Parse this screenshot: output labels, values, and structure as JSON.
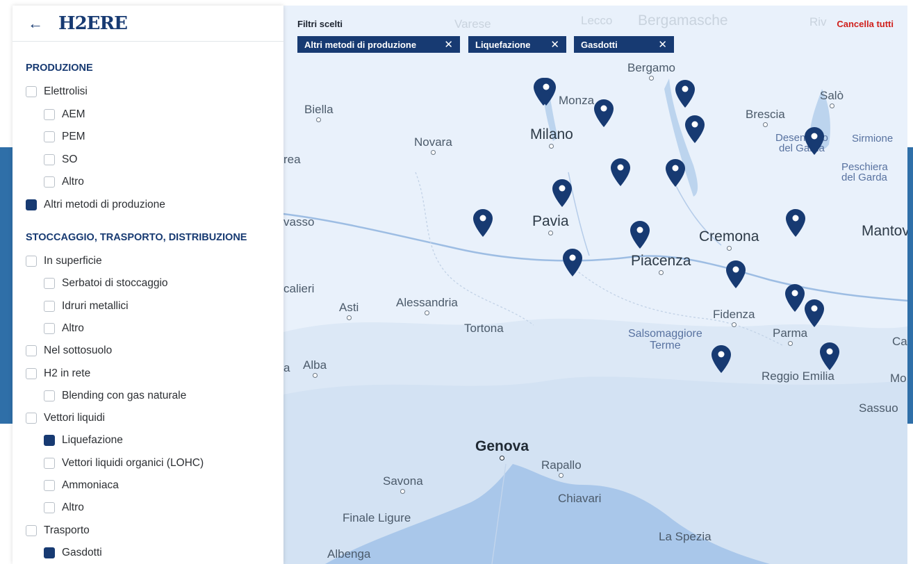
{
  "header": {
    "back_icon": "arrow-left-icon",
    "logo": "H2ERE"
  },
  "filters": {
    "title": "Filtri scelti",
    "clear_all": "Cancella tutti",
    "chips": [
      {
        "label": "Altri metodi di produzione",
        "close": "✕"
      },
      {
        "label": "Liquefazione",
        "close": "✕"
      },
      {
        "label": "Gasdotti",
        "close": "✕"
      }
    ]
  },
  "sidebar": {
    "sections": [
      {
        "title": "PRODUZIONE",
        "items": [
          {
            "label": "Elettrolisi",
            "checked": false,
            "level": 0
          },
          {
            "label": "AEM",
            "checked": false,
            "level": 1
          },
          {
            "label": "PEM",
            "checked": false,
            "level": 1
          },
          {
            "label": "SO",
            "checked": false,
            "level": 1
          },
          {
            "label": "Altro",
            "checked": false,
            "level": 1
          },
          {
            "label": "Altri metodi di produzione",
            "checked": true,
            "level": 0
          }
        ]
      },
      {
        "title": "STOCCAGGIO, TRASPORTO, DISTRIBUZIONE",
        "items": [
          {
            "label": "In superficie",
            "checked": false,
            "level": 0
          },
          {
            "label": "Serbatoi di stoccaggio",
            "checked": false,
            "level": 1
          },
          {
            "label": "Idruri metallici",
            "checked": false,
            "level": 1
          },
          {
            "label": "Altro",
            "checked": false,
            "level": 1
          },
          {
            "label": "Nel sottosuolo",
            "checked": false,
            "level": 0
          },
          {
            "label": "H2 in rete",
            "checked": false,
            "level": 0
          },
          {
            "label": "Blending con gas naturale",
            "checked": false,
            "level": 1
          },
          {
            "label": "Vettori liquidi",
            "checked": false,
            "level": 0
          },
          {
            "label": "Liquefazione",
            "checked": true,
            "level": 1
          },
          {
            "label": "Vettori liquidi organici (LOHC)",
            "checked": false,
            "level": 1
          },
          {
            "label": "Ammoniaca",
            "checked": false,
            "level": 1
          },
          {
            "label": "Altro",
            "checked": false,
            "level": 1
          },
          {
            "label": "Trasporto",
            "checked": false,
            "level": 0
          },
          {
            "label": "Gasdotti",
            "checked": true,
            "level": 1
          }
        ]
      }
    ]
  },
  "map": {
    "cities": {
      "varese": "Varese",
      "lecco": "Lecco",
      "bergamasche": "Bergamasche",
      "riv": "Riv",
      "bergamo": "Bergamo",
      "monza": "Monza",
      "biella": "Biella",
      "salo": "Salò",
      "brescia": "Brescia",
      "milano": "Milano",
      "novara": "Novara",
      "desenzano": "Desenzano\ndel Garda",
      "sirmione": "Sirmione",
      "peschiera": "Peschiera\ndel Garda",
      "rea": "rea",
      "vasso": "vasso",
      "pavia": "Pavia",
      "cremona": "Cremona",
      "mantova": "Mantov",
      "piacenza": "Piacenza",
      "calieri": "calieri",
      "asti": "Asti",
      "alessandria": "Alessandria",
      "tortona": "Tortona",
      "fidenza": "Fidenza",
      "salsomaggiore": "Salsomaggiore\nTerme",
      "parma": "Parma",
      "ca": "Ca",
      "a": "a",
      "alba": "Alba",
      "reggio": "Reggio Emilia",
      "mo": "Mo",
      "sassuolo": "Sassuo",
      "genova": "Genova",
      "rapallo": "Rapallo",
      "savona": "Savona",
      "chiavari": "Chiavari",
      "finale": "Finale Ligure",
      "laspezia": "La Spezia",
      "albenga": "Albenga"
    },
    "pin_count": 18,
    "pin_color": "#173a72",
    "pin_icon": "map-marker-icon"
  },
  "colors": {
    "brand": "#173a72",
    "accent_red": "#d0201c",
    "band": "#2f6fa8",
    "sea": "#a9c7ea"
  }
}
